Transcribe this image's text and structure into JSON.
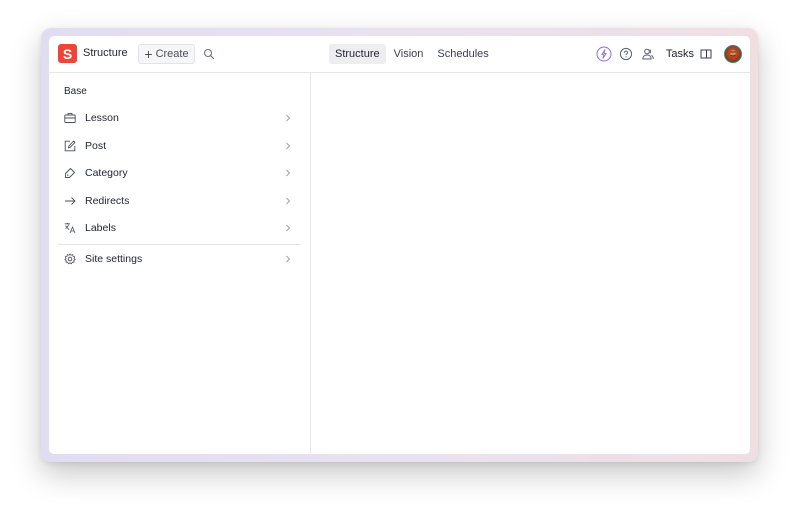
{
  "app": {
    "logo_letter": "S",
    "title": "Structure",
    "brand_color": "#f0443a"
  },
  "toolbar": {
    "create_label": "Create",
    "create_icon": "plus-icon",
    "search_icon": "search-icon"
  },
  "nav": {
    "tabs": [
      {
        "label": "Structure",
        "active": true
      },
      {
        "label": "Vision",
        "active": false
      },
      {
        "label": "Schedules",
        "active": false
      }
    ]
  },
  "right_tools": {
    "icons": [
      "bolt-icon",
      "help-icon",
      "users-icon"
    ],
    "tasks_label": "Tasks",
    "tasks_icon": "sidebar-panel-icon",
    "avatar": "user-avatar"
  },
  "sidebar": {
    "section_title": "Base",
    "items": [
      {
        "label": "Lesson",
        "icon": "briefcase-icon"
      },
      {
        "label": "Post",
        "icon": "edit-icon"
      },
      {
        "label": "Category",
        "icon": "tag-icon"
      },
      {
        "label": "Redirects",
        "icon": "arrow-right-icon"
      },
      {
        "label": "Labels",
        "icon": "translate-icon"
      }
    ],
    "footer_items": [
      {
        "label": "Site settings",
        "icon": "gear-icon"
      }
    ]
  }
}
